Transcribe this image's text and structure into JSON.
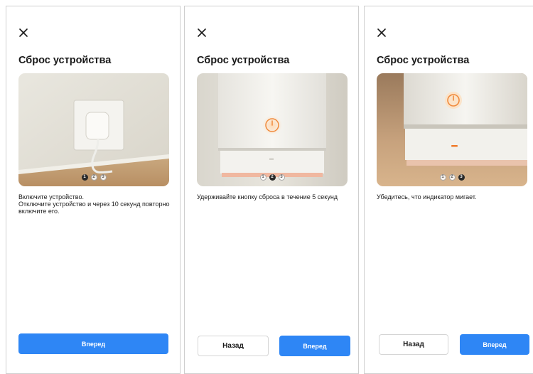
{
  "colors": {
    "primary": "#2e86f5",
    "panel_border": "#cfcfcf",
    "text": "#1a1a1a",
    "power_led": "#f08a3c"
  },
  "panels": [
    {
      "close_icon": "close-icon",
      "title": "Сброс устройства",
      "image": "plug-in-wall-socket",
      "dots": [
        "1",
        "2",
        "3"
      ],
      "active_step": 1,
      "description": [
        "Включите устройство.",
        "Отключите устройство и через 10 секунд повторно включите его."
      ],
      "back_label": "",
      "next_label": "Вперед"
    },
    {
      "close_icon": "close-icon",
      "title": "Сброс устройства",
      "image": "device-power-button",
      "dots": [
        "1",
        "2",
        "3"
      ],
      "active_step": 2,
      "description": [
        "Удерживайте кнопку сброса в течение 5 секунд"
      ],
      "back_label": "Назад",
      "next_label": "Вперед"
    },
    {
      "close_icon": "close-icon",
      "title": "Сброс устройства",
      "image": "device-indicator-light",
      "dots": [
        "1",
        "2",
        "3"
      ],
      "active_step": 3,
      "description": [
        "Убедитесь, что индикатор мигает."
      ],
      "back_label": "Назад",
      "next_label": "Вперед"
    }
  ]
}
